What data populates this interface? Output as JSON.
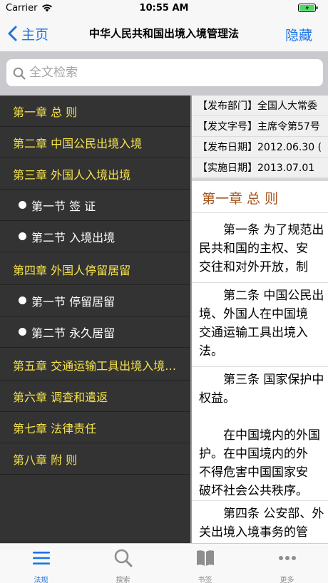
{
  "status_bar": {
    "carrier": "Carrier",
    "time": "10:55 AM"
  },
  "nav": {
    "back_label": "主页",
    "title": "中华人民共和国出境入境管理法",
    "hide_label": "隐藏"
  },
  "search": {
    "placeholder": "全文检索"
  },
  "sidebar": {
    "items": [
      {
        "label": "第一章 总 则",
        "type": "chapter"
      },
      {
        "label": "第二章 中国公民出境入境",
        "type": "chapter"
      },
      {
        "label": "第三章 外国人入境出境",
        "type": "chapter"
      },
      {
        "label": "第一节 签 证",
        "type": "section"
      },
      {
        "label": "第二节 入境出境",
        "type": "section"
      },
      {
        "label": "第四章 外国人停留居留",
        "type": "chapter"
      },
      {
        "label": "第一节 停留居留",
        "type": "section"
      },
      {
        "label": "第二节 永久居留",
        "type": "section"
      },
      {
        "label": "第五章 交通运输工具出境入境边防检查",
        "type": "chapter"
      },
      {
        "label": "第六章 调查和遣返",
        "type": "chapter"
      },
      {
        "label": "第七章 法律责任",
        "type": "chapter"
      },
      {
        "label": "第八章 附 则",
        "type": "chapter"
      }
    ]
  },
  "content": {
    "meta": [
      "【发布部门】全国人大常委",
      "【发文字号】主席令第57号",
      "【发布日期】2012.06.30 (",
      "【实施日期】2013.07.01"
    ],
    "chapter_heading": "第一章 总 则",
    "paragraphs": [
      [
        "　　第一条 为了规范出",
        "民共和国的主权、安",
        "交往和对外开放，制"
      ],
      [
        "　　第二条 中国公民出",
        "境、外国人在中国境",
        "交通运输工具出境入",
        "法。"
      ],
      [
        "　　第三条 国家保护中",
        "权益。",
        "",
        "　　在中国境内的外国",
        "护。在中国境内的外",
        "不得危害中国国家安",
        "破坏社会公共秩序。"
      ],
      [
        "　　第四条 公安部、外",
        "关出境入境事务的管"
      ]
    ]
  },
  "tabs": [
    {
      "label": "法规",
      "icon": "list-icon",
      "active": true
    },
    {
      "label": "搜索",
      "icon": "search-icon",
      "active": false
    },
    {
      "label": "书签",
      "icon": "book-icon",
      "active": false
    },
    {
      "label": "更多",
      "icon": "more-icon",
      "active": false
    }
  ],
  "colors": {
    "accent": "#1a73e8",
    "chapter_text": "#f5e34a",
    "sidebar_bg": "#333333",
    "heading": "#a5541c"
  }
}
